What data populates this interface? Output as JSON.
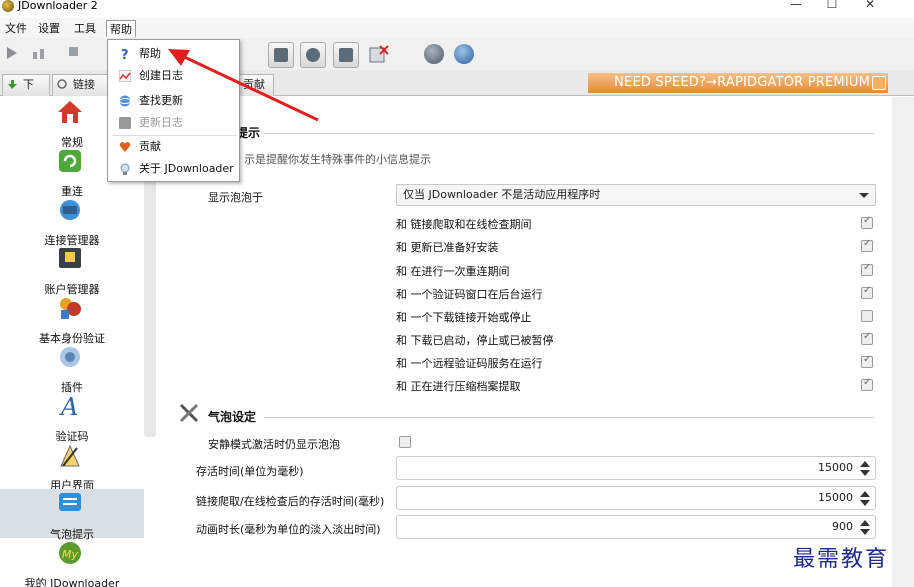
{
  "window": {
    "title": "JDownloader 2",
    "controls": {
      "minimize": "—",
      "maximize": "☐",
      "close": "✕"
    }
  },
  "menubar": [
    {
      "label": "文件"
    },
    {
      "label": "设置"
    },
    {
      "label": "工具"
    },
    {
      "label": "帮助",
      "active": true
    }
  ],
  "help_menu": [
    {
      "label": "帮助",
      "icon": "question-icon"
    },
    {
      "label": "创建日志",
      "icon": "log-chart-icon"
    },
    {
      "label": "查找更新",
      "icon": "update-globe-icon"
    },
    {
      "label": "更新日志",
      "icon": "changelog-icon",
      "disabled": true
    },
    {
      "label": "贡献",
      "icon": "heart-icon"
    },
    {
      "label": "关于 JDownloader",
      "icon": "lightbulb-icon"
    }
  ],
  "tabs": [
    {
      "label": "下载"
    },
    {
      "label": "链接"
    },
    {
      "label": "贡献"
    }
  ],
  "promo": {
    "text": "NEED SPEED?→RAPIDGATOR PREMIUM"
  },
  "sidebar": [
    {
      "label": "常规",
      "icon": "home-icon"
    },
    {
      "label": "重连",
      "icon": "reconnect-icon"
    },
    {
      "label": "连接管理器",
      "icon": "connection-manager-icon"
    },
    {
      "label": "账户管理器",
      "icon": "account-manager-icon"
    },
    {
      "label": "基本身份验证",
      "icon": "basic-auth-icon"
    },
    {
      "label": "插件",
      "icon": "plugin-icon"
    },
    {
      "label": "验证码",
      "icon": "captcha-icon"
    },
    {
      "label": "用户界面",
      "icon": "user-interface-icon"
    },
    {
      "label": "气泡提示",
      "icon": "bubble-icon",
      "selected": true
    },
    {
      "label": "我的 JDownloader",
      "icon": "my-jdownloader-icon"
    }
  ],
  "main": {
    "section1_title": "提示",
    "section1_desc": "示是提醒你发生特殊事件的小信息提示",
    "show_bubble_label": "显示泡泡于",
    "show_bubble_value": "仅当 JDownloader 不是活动应用程序时",
    "options": [
      {
        "label": "和 链接爬取和在线检查期间",
        "checked": true
      },
      {
        "label": "和 更新已准备好安装",
        "checked": true
      },
      {
        "label": "和 在进行一次重连期间",
        "checked": true
      },
      {
        "label": "和 一个验证码窗口在后台运行",
        "checked": true
      },
      {
        "label": "和 一个下载链接开始或停止",
        "checked": false
      },
      {
        "label": "和 下载已启动，停止或已被暂停",
        "checked": true
      },
      {
        "label": "和 一个远程验证码服务在运行",
        "checked": true
      },
      {
        "label": "和 正在进行压缩档案提取",
        "checked": true
      }
    ],
    "section2_title": "气泡设定",
    "silent_mode_label": "安静模式激活时仍显示泡泡",
    "silent_mode_checked": false,
    "fields": [
      {
        "label": "存活时间(单位为毫秒)",
        "value": "15000"
      },
      {
        "label": "链接爬取/在线检查后的存活时间(毫秒)",
        "value": "15000"
      },
      {
        "label": "动画时长(毫秒为单位的淡入淡出时间)",
        "value": "900"
      }
    ]
  },
  "watermark": "最需教育",
  "colors": {
    "annotation_arrow": "#e02020",
    "promo": "#e8913a",
    "sidebar_selected": "#dadfe4"
  }
}
